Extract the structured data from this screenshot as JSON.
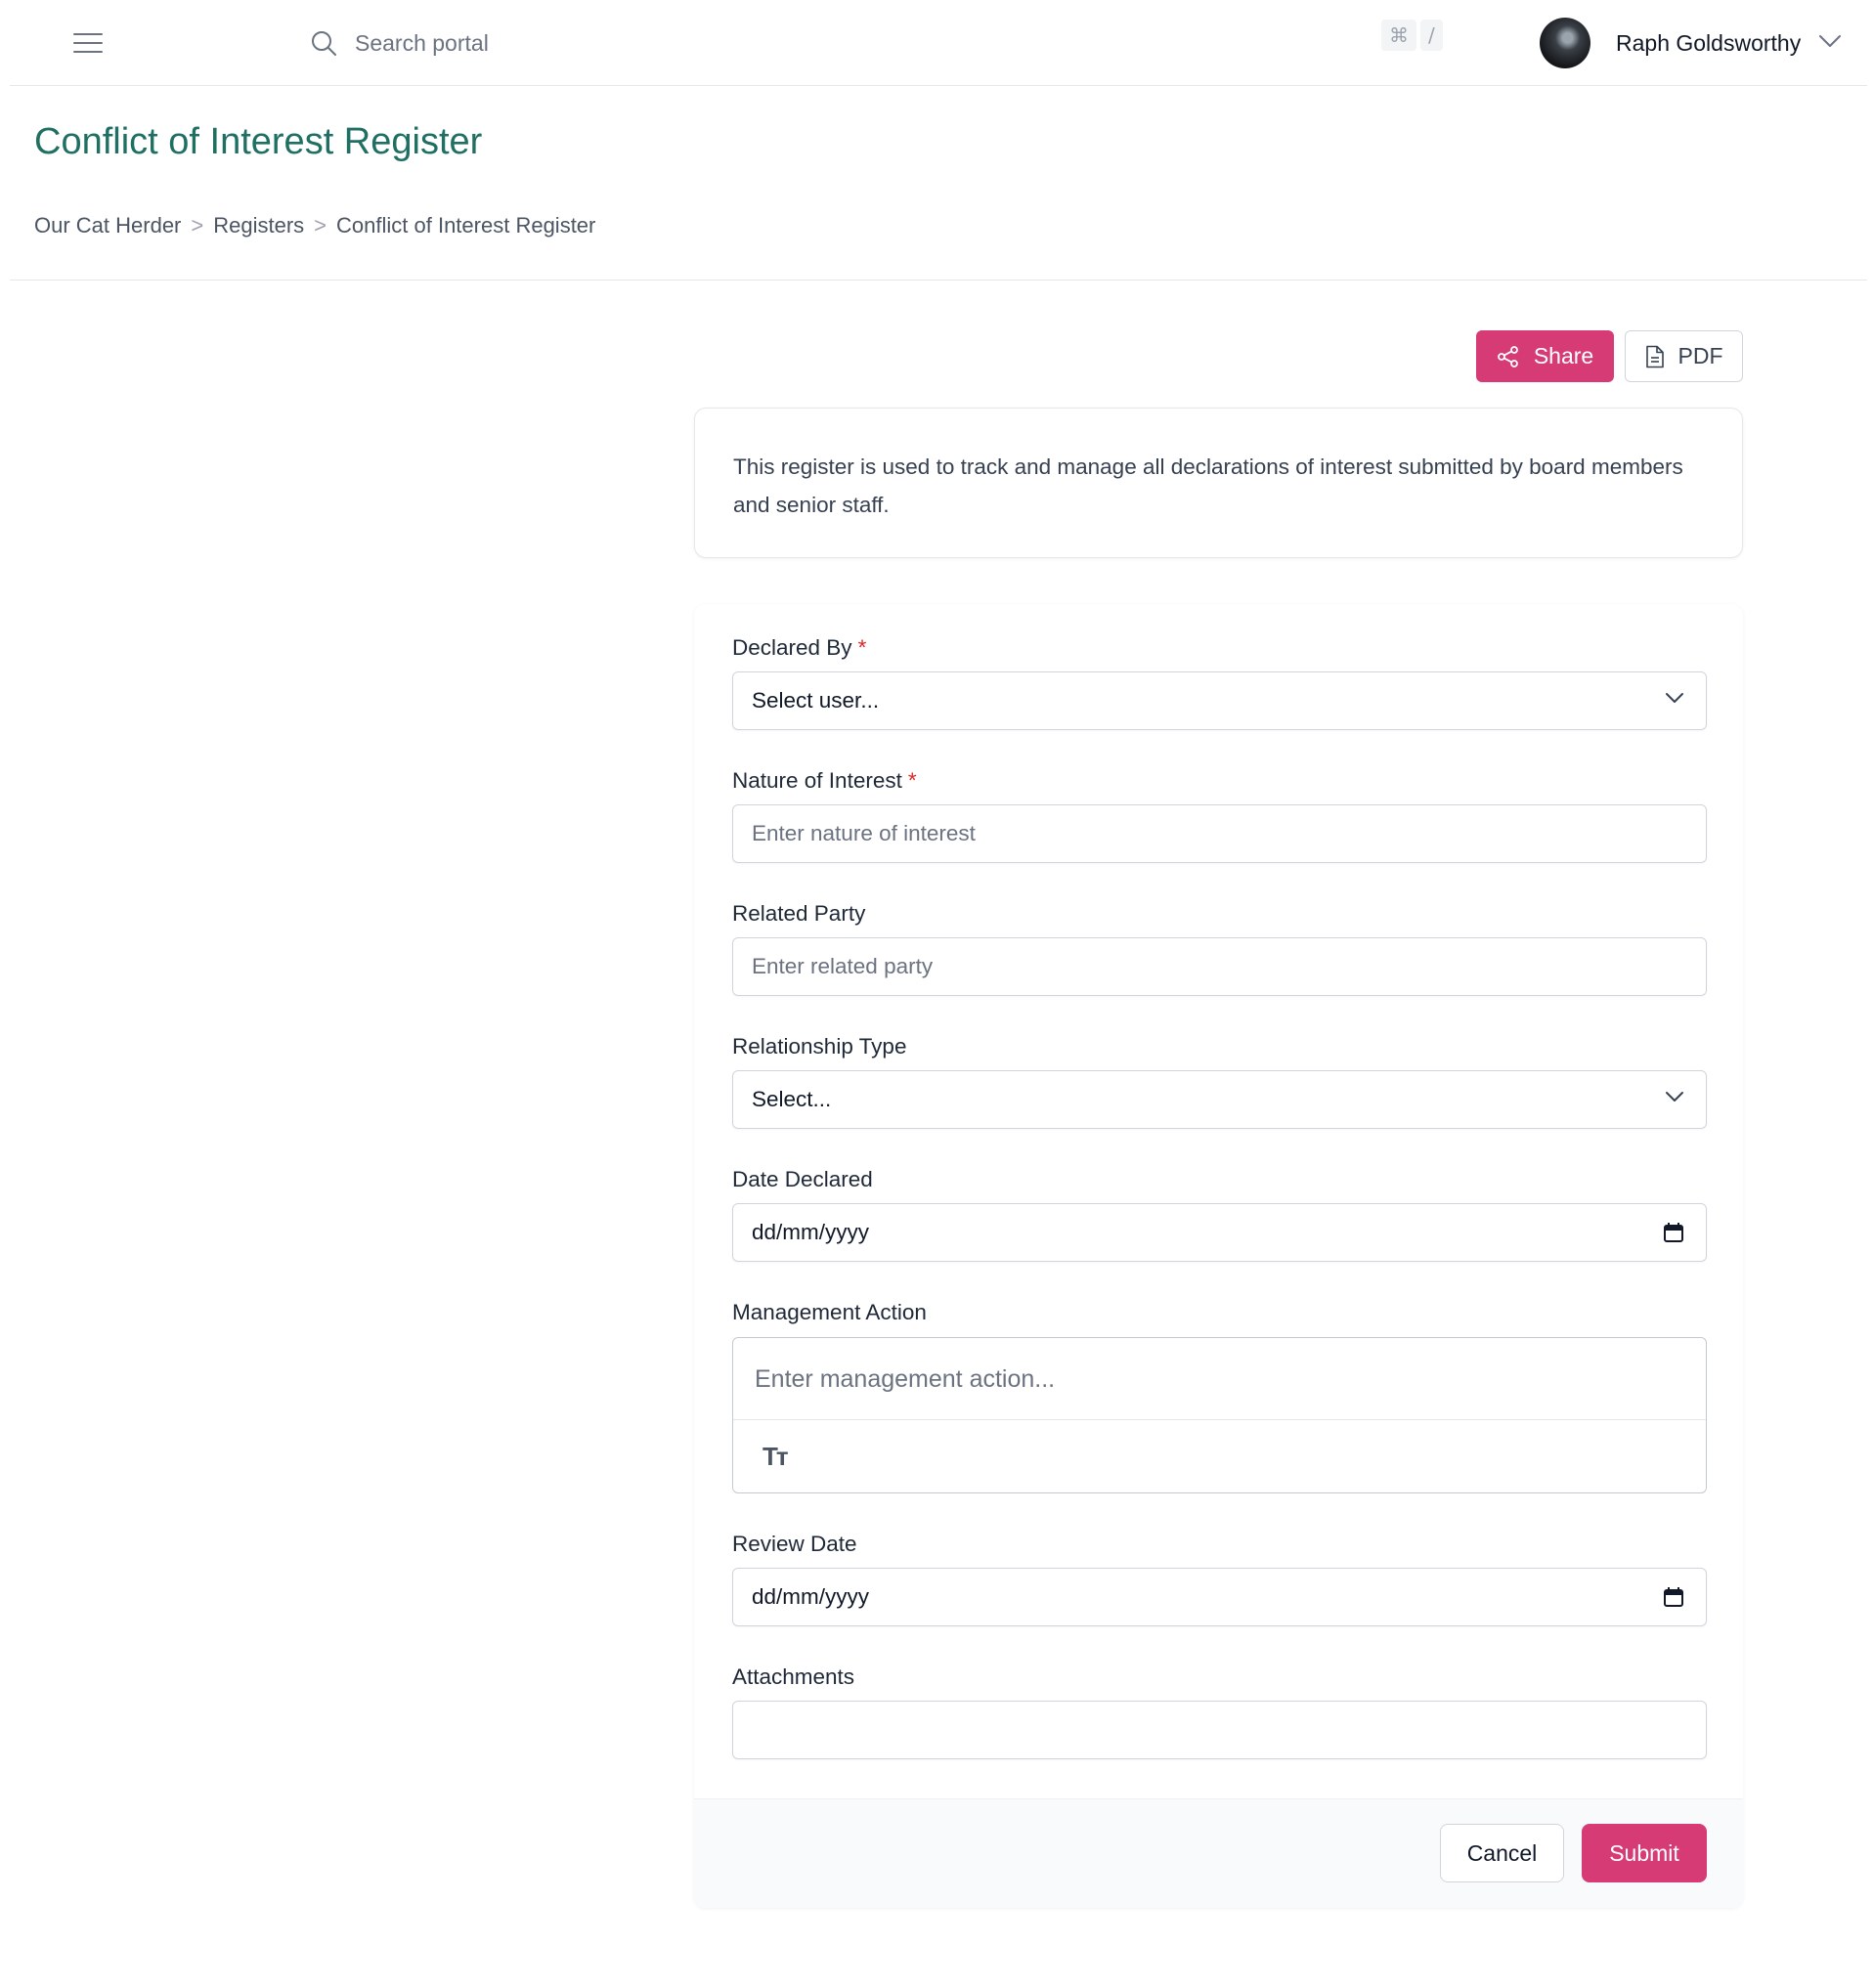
{
  "topbar": {
    "search_placeholder": "Search portal",
    "shortcut_keys": [
      "⌘",
      "/"
    ],
    "user_name": "Raph Goldsworthy"
  },
  "header": {
    "title": "Conflict of Interest Register",
    "breadcrumb": [
      "Our Cat Herder",
      "Registers",
      "Conflict of Interest Register"
    ],
    "breadcrumb_separator": ">"
  },
  "actions": {
    "share_label": "Share",
    "pdf_label": "PDF"
  },
  "description": "This register is used to track and manage all declarations of interest submitted by board members and senior staff.",
  "form": {
    "fields": {
      "declared_by": {
        "label": "Declared By",
        "required_mark": "*",
        "value": "Select user..."
      },
      "nature_of_interest": {
        "label": "Nature of Interest",
        "required_mark": "*",
        "placeholder": "Enter nature of interest"
      },
      "related_party": {
        "label": "Related Party",
        "placeholder": "Enter related party"
      },
      "relationship_type": {
        "label": "Relationship Type",
        "value": "Select..."
      },
      "date_declared": {
        "label": "Date Declared",
        "value": "dd/mm/yyyy"
      },
      "management_action": {
        "label": "Management Action",
        "placeholder": "Enter management action...",
        "toolbar_icon_text": "Tт"
      },
      "review_date": {
        "label": "Review Date",
        "value": "dd/mm/yyyy"
      },
      "attachments": {
        "label": "Attachments",
        "value": ""
      }
    },
    "cancel_label": "Cancel",
    "submit_label": "Submit"
  },
  "colors": {
    "accent": "#d63b75",
    "title": "#1f6f63",
    "required": "#dc2626"
  }
}
